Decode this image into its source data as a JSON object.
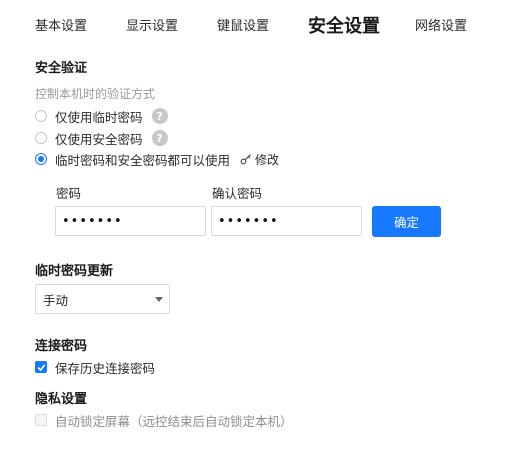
{
  "tabs": [
    {
      "label": "基本设置"
    },
    {
      "label": "显示设置"
    },
    {
      "label": "键鼠设置"
    },
    {
      "label": "安全设置"
    },
    {
      "label": "网络设置"
    }
  ],
  "security": {
    "title": "安全验证",
    "subtitle": "控制本机时的验证方式",
    "options": [
      {
        "label": "仅使用临时密码",
        "checked": false
      },
      {
        "label": "仅使用安全密码",
        "checked": false
      },
      {
        "label": "临时密码和安全密码都可以使用",
        "checked": true
      }
    ],
    "help_glyph": "?",
    "edit_label": "修改",
    "password_label": "密码",
    "password_value": "•••••••",
    "confirm_label": "确认密码",
    "confirm_value": "•••••••",
    "confirm_button": "确定"
  },
  "temp_update": {
    "title": "临时密码更新",
    "selected": "手动"
  },
  "connect_password": {
    "title": "连接密码",
    "save_history_label": "保存历史连接密码",
    "save_history_checked": true
  },
  "privacy": {
    "title": "隐私设置",
    "auto_lock_label": "自动锁定屏幕（远控结束后自动锁定本机）",
    "auto_lock_checked": false,
    "auto_lock_disabled": true
  },
  "colors": {
    "accent": "#1677ff",
    "help_bg": "#c8c8c8",
    "muted_text": "#9a9a9a"
  },
  "icons": {
    "help": "question-circle-icon",
    "edit": "key-icon",
    "dropdown": "caret-down-icon",
    "check": "check-icon"
  }
}
